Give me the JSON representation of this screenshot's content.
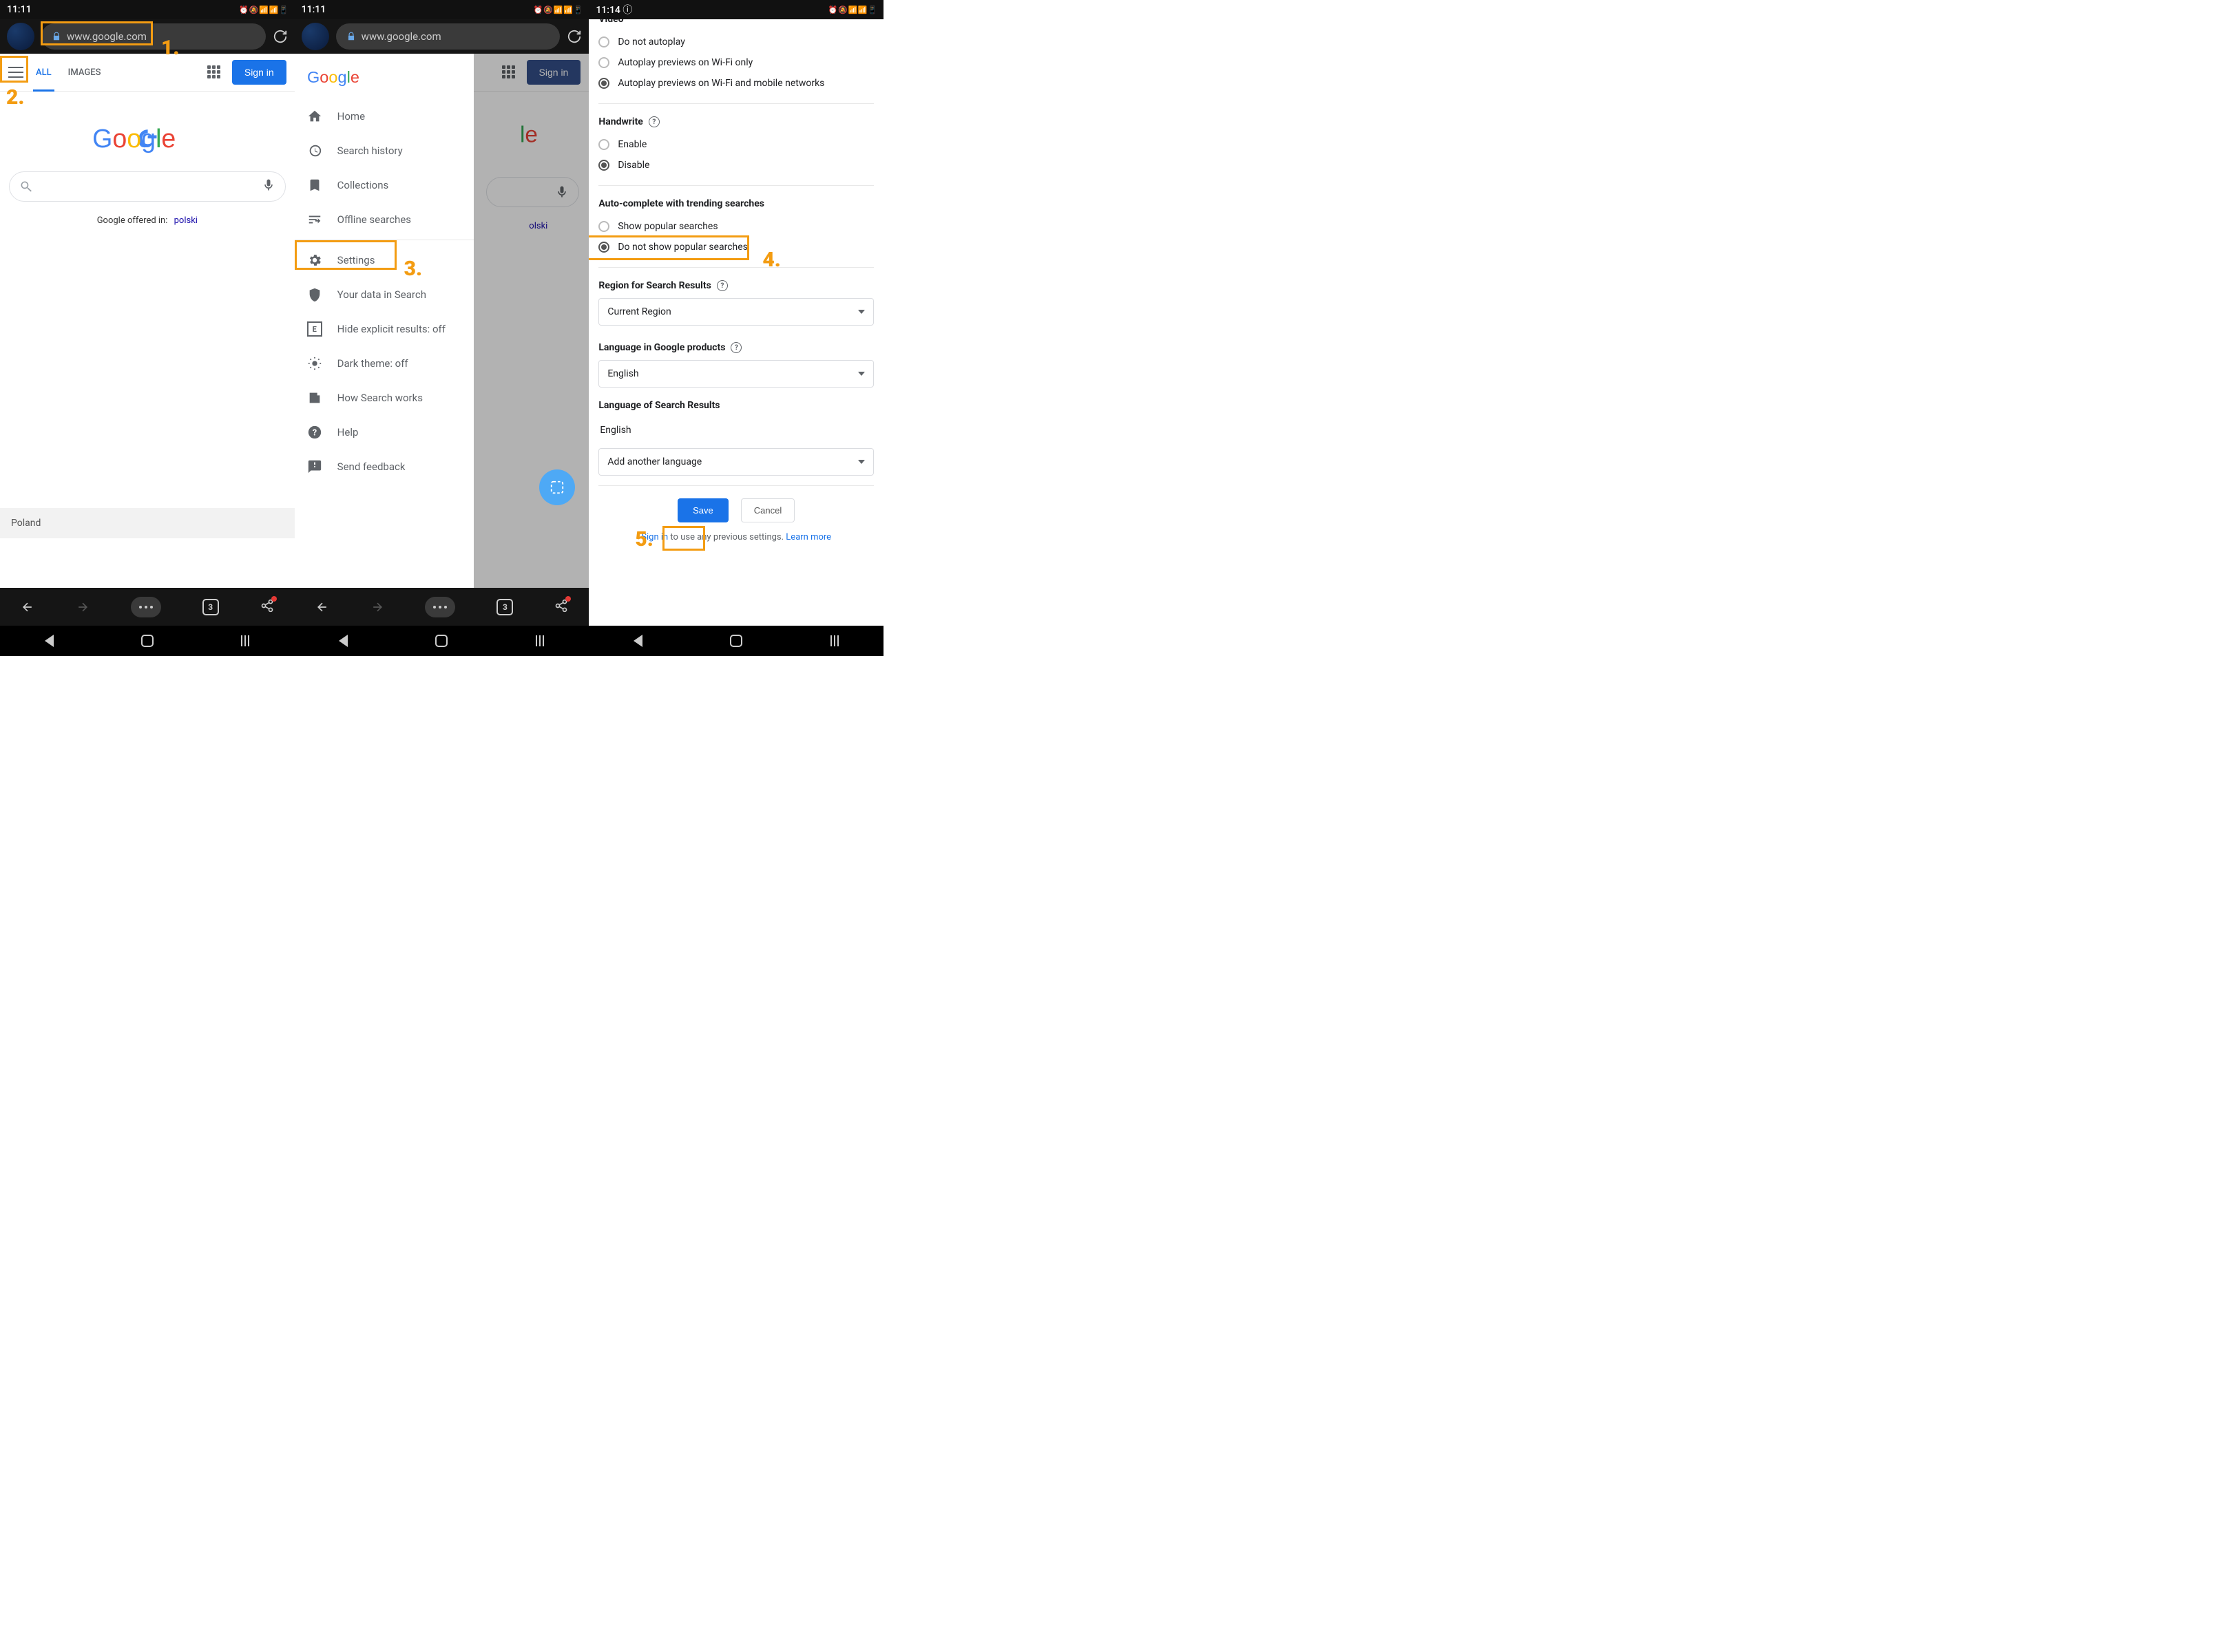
{
  "panel1": {
    "status_time": "11:11",
    "url": "www.google.com",
    "tabs": {
      "all": "ALL",
      "images": "IMAGES"
    },
    "sign_in": "Sign in",
    "offered_text": "Google offered in:",
    "offered_lang": "polski",
    "footer": "Poland",
    "tab_count": "3",
    "annotations": {
      "a1": "1.",
      "a2": "2."
    }
  },
  "panel2": {
    "status_time": "11:11",
    "url": "www.google.com",
    "sign_in": "Sign in",
    "offered_lang": "olski",
    "tab_count": "3",
    "drawer": {
      "home": "Home",
      "history": "Search history",
      "collections": "Collections",
      "offline": "Offline searches",
      "settings": "Settings",
      "yourdata": "Your data in Search",
      "explicit": "Hide explicit results: off",
      "dark": "Dark theme: off",
      "howworks": "How Search works",
      "help": "Help",
      "feedback": "Send feedback"
    },
    "annotations": {
      "a3": "3."
    }
  },
  "panel3": {
    "status_time": "11:14",
    "video": {
      "title": "Video",
      "opt1": "Do not autoplay",
      "opt2": "Autoplay previews on Wi-Fi only",
      "opt3": "Autoplay previews on Wi-Fi and mobile networks"
    },
    "handwrite": {
      "title": "Handwrite",
      "enable": "Enable",
      "disable": "Disable"
    },
    "autocomplete": {
      "title": "Auto-complete with trending searches",
      "show": "Show popular searches",
      "noshow": "Do not show popular searches"
    },
    "region": {
      "title": "Region for Search Results",
      "value": "Current Region"
    },
    "langprod": {
      "title": "Language in Google products",
      "value": "English"
    },
    "langresults": {
      "title": "Language of Search Results",
      "current": "English",
      "add": "Add another language"
    },
    "buttons": {
      "save": "Save",
      "cancel": "Cancel"
    },
    "signin_pre": "Sign in",
    "signin_mid": " to use any previous settings. ",
    "signin_link": "Learn more",
    "annotations": {
      "a4": "4.",
      "a5": "5."
    }
  }
}
